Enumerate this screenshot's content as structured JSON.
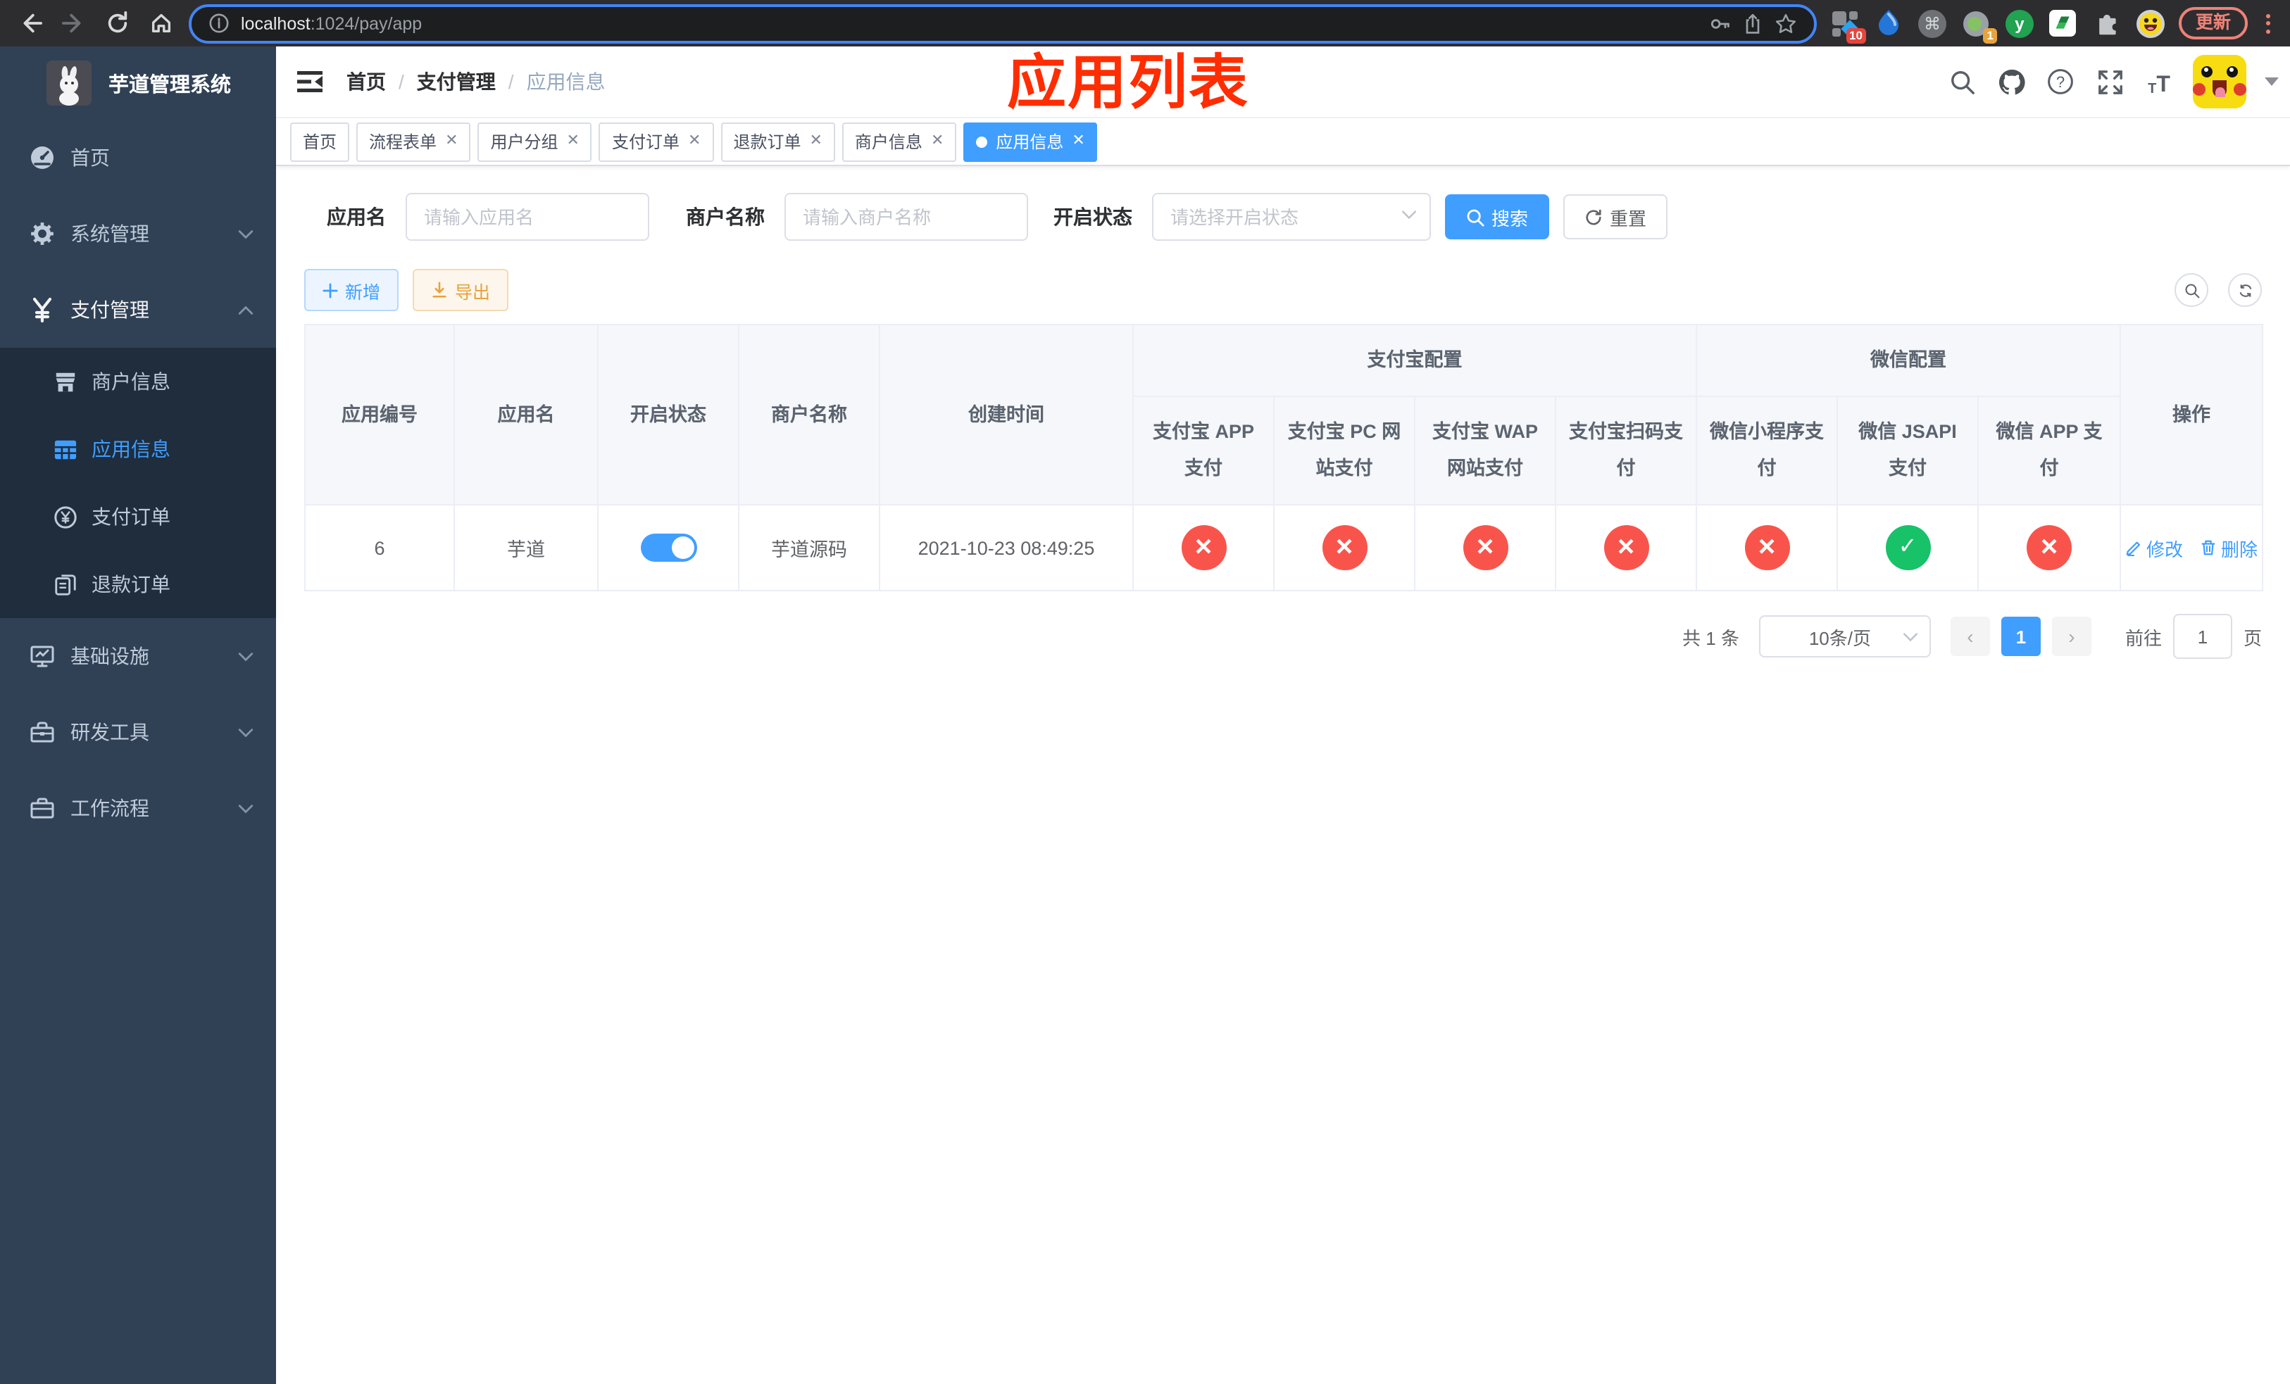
{
  "browser": {
    "url": {
      "host": "localhost",
      "path": ":1024/pay/app"
    },
    "update_label": "更新",
    "extensions": {
      "badge_monkey": "10",
      "badge_proxy": "1",
      "cmd_symbol": "⌘",
      "y_letter": "y"
    }
  },
  "sidebar": {
    "logo_title": "芋道管理系统",
    "items": [
      {
        "label": "首页"
      },
      {
        "label": "系统管理"
      },
      {
        "label": "支付管理"
      },
      {
        "label": "商户信息"
      },
      {
        "label": "应用信息"
      },
      {
        "label": "支付订单"
      },
      {
        "label": "退款订单"
      },
      {
        "label": "基础设施"
      },
      {
        "label": "研发工具"
      },
      {
        "label": "工作流程"
      }
    ]
  },
  "header": {
    "breadcrumb": [
      "首页",
      "支付管理",
      "应用信息"
    ],
    "annotation": "应用列表"
  },
  "tabs": [
    {
      "label": "首页"
    },
    {
      "label": "流程表单"
    },
    {
      "label": "用户分组"
    },
    {
      "label": "支付订单"
    },
    {
      "label": "退款订单"
    },
    {
      "label": "商户信息"
    },
    {
      "label": "应用信息"
    }
  ],
  "filters": {
    "app_name": {
      "label": "应用名",
      "placeholder": "请输入应用名"
    },
    "merchant_name": {
      "label": "商户名称",
      "placeholder": "请输入商户名称"
    },
    "status": {
      "label": "开启状态",
      "placeholder": "请选择开启状态"
    },
    "search_label": "搜索",
    "reset_label": "重置"
  },
  "toolbar": {
    "add_label": "新增",
    "export_label": "导出"
  },
  "table": {
    "columns": [
      "应用编号",
      "应用名",
      "开启状态",
      "商户名称",
      "创建时间"
    ],
    "groups": [
      {
        "label": "支付宝配置",
        "children": [
          "支付宝 APP 支付",
          "支付宝 PC 网站支付",
          "支付宝 WAP 网站支付",
          "支付宝扫码支付"
        ]
      },
      {
        "label": "微信配置",
        "children": [
          "微信小程序支付",
          "微信 JSAPI 支付",
          "微信 APP 支付"
        ]
      }
    ],
    "action_col": "操作",
    "row": {
      "id": "6",
      "name": "芋道",
      "switch": "on",
      "merchant": "芋道源码",
      "created": "2021-10-23 08:49:25",
      "configs": [
        "cross",
        "cross",
        "cross",
        "cross",
        "cross",
        "check",
        "cross"
      ],
      "edit_label": "修改",
      "delete_label": "删除"
    }
  },
  "pagination": {
    "total": "共 1 条",
    "page_size": "10条/页",
    "page": "1",
    "goto_label": "前往",
    "goto_value": "1",
    "page_suffix": "页"
  },
  "colors": {
    "primary": "#409eff",
    "success": "#17c268",
    "danger": "#f9544b",
    "annotation": "#ff2d00"
  }
}
